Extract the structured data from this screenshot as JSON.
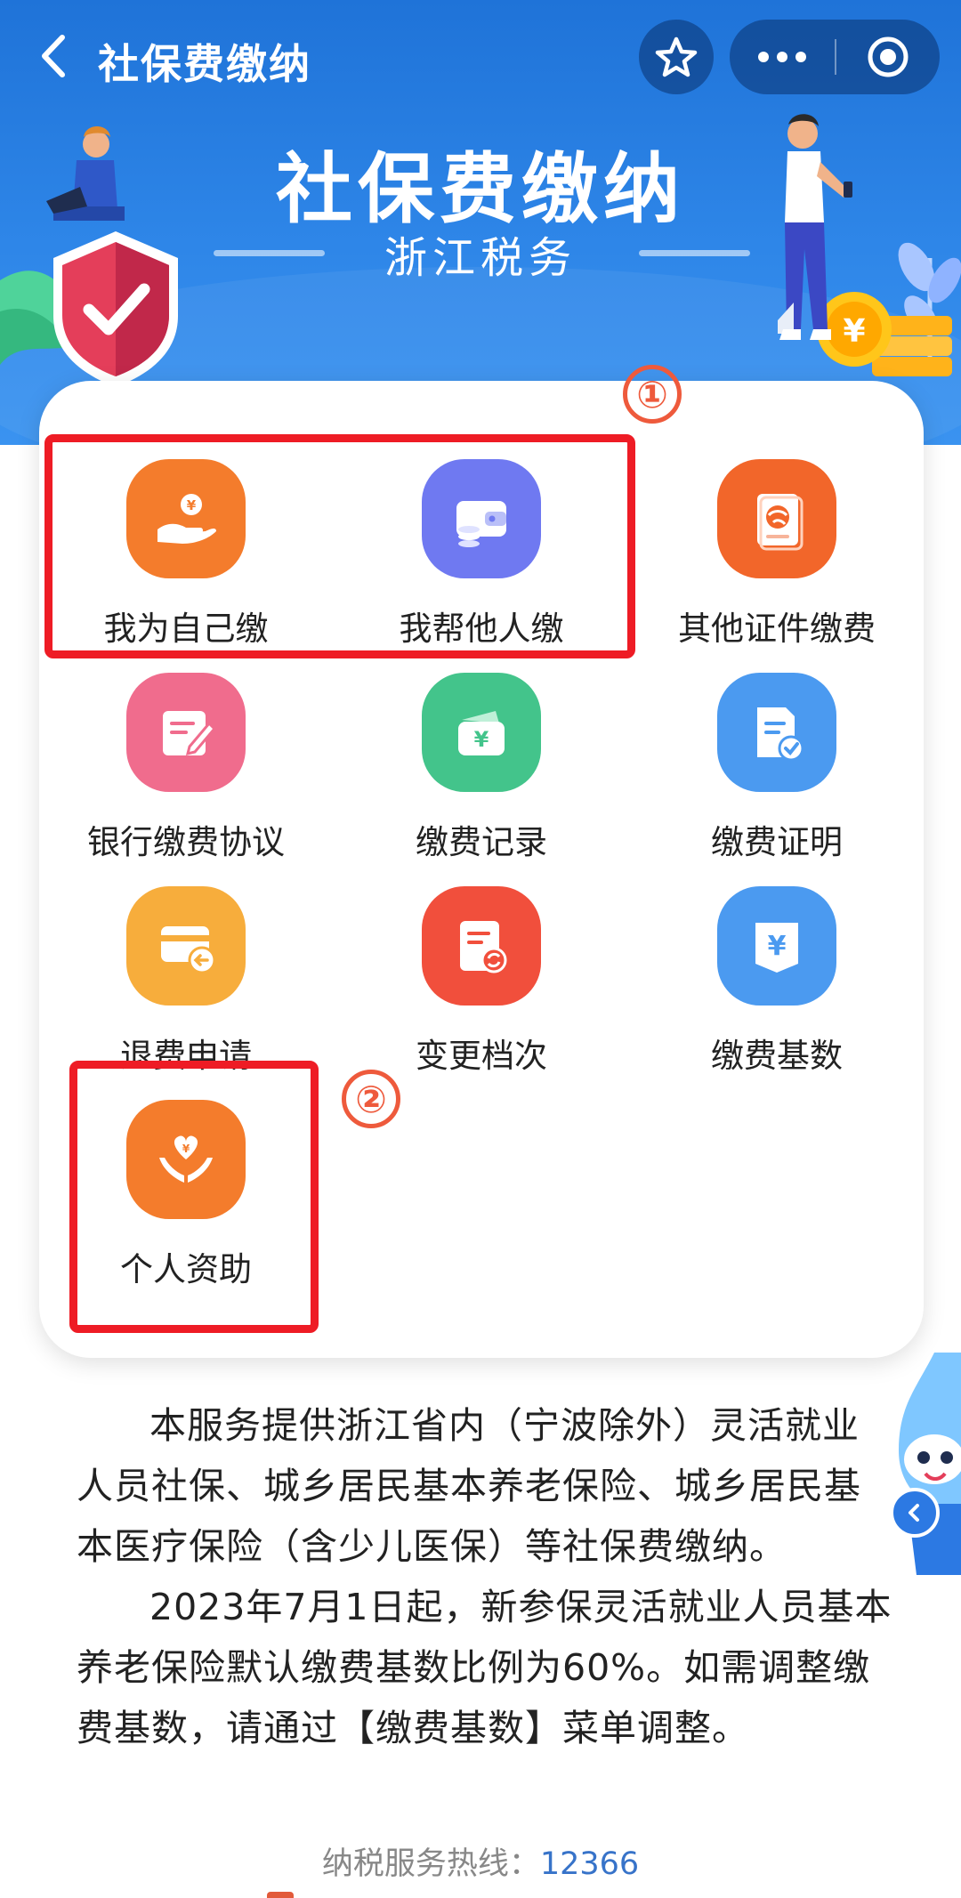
{
  "navbar": {
    "title": "社保费缴纳",
    "back_icon": "chevron-left-icon",
    "star_icon": "star-icon",
    "more_icon": "more-dots-icon",
    "close_icon": "target-circle-icon"
  },
  "hero": {
    "title": "社保费缴纳",
    "subtitle": "浙江税务"
  },
  "grid": [
    {
      "label": "我为自己缴",
      "icon": "hand-coin-icon",
      "color": "#f47c2c"
    },
    {
      "label": "我帮他人缴",
      "icon": "wallet-icon",
      "color": "#6f79f1"
    },
    {
      "label": "其他证件缴费",
      "icon": "passport-icon",
      "color": "#f2662a"
    },
    {
      "label": "银行缴费协议",
      "icon": "document-edit-icon",
      "color": "#f06c8d"
    },
    {
      "label": "缴费记录",
      "icon": "wallet-yuan-icon",
      "color": "#43c48b"
    },
    {
      "label": "缴费证明",
      "icon": "document-check-icon",
      "color": "#4b9af0"
    },
    {
      "label": "退费申请",
      "icon": "card-refund-icon",
      "color": "#f7ad3c"
    },
    {
      "label": "变更档次",
      "icon": "document-refresh-icon",
      "color": "#f14f3c"
    },
    {
      "label": "缴费基数",
      "icon": "yuan-badge-icon",
      "color": "#4b9af0"
    },
    {
      "label": "个人资助",
      "icon": "hands-heart-icon",
      "color": "#f47c2c"
    }
  ],
  "annotations": {
    "marker1": "1",
    "marker2": "2",
    "highlight_color": "#ee1c25"
  },
  "description": {
    "paragraph1": "本服务提供浙江省内（宁波除外）灵活就业人员社保、城乡居民基本养老保险、城乡居民基本医疗保险（含少儿医保）等社保费缴纳。",
    "paragraph2": "2023年7月1日起，新参保灵活就业人员基本养老保险默认缴费基数比例为60%。如需调整缴费基数，请通过【缴费基数】菜单调整。"
  },
  "hotline": {
    "label": "纳税服务热线：",
    "number": "12366"
  },
  "colors": {
    "banner_top": "#1f73d8",
    "banner_bottom": "#3a93f0",
    "hotline_number": "#3773c9"
  }
}
